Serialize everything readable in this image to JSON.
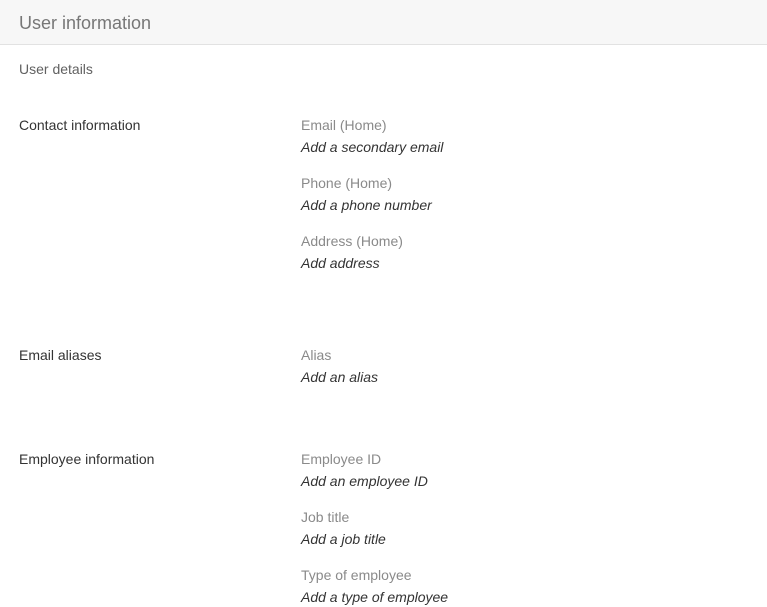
{
  "header": {
    "title": "User information"
  },
  "subheader": {
    "label": "User details"
  },
  "sections": {
    "contact": {
      "label": "Contact information",
      "fields": [
        {
          "label": "Email (Home)",
          "value": "Add a secondary email"
        },
        {
          "label": "Phone (Home)",
          "value": "Add a phone number"
        },
        {
          "label": "Address (Home)",
          "value": "Add address"
        }
      ]
    },
    "aliases": {
      "label": "Email aliases",
      "fields": [
        {
          "label": "Alias",
          "value": "Add an alias"
        }
      ]
    },
    "employee": {
      "label": "Employee information",
      "fields": [
        {
          "label": "Employee ID",
          "value": "Add an employee ID"
        },
        {
          "label": "Job title",
          "value": "Add a job title"
        },
        {
          "label": "Type of employee",
          "value": "Add a type of employee"
        }
      ]
    }
  }
}
